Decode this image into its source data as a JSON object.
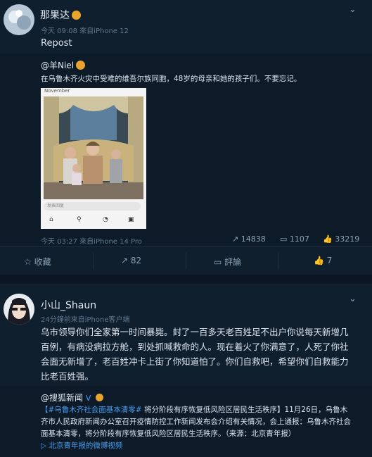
{
  "post1": {
    "user": "那果达",
    "meta": "今天 09:08 來自iPhone 12",
    "text": "Repost",
    "repost": {
      "user": "@羊Niel",
      "text": "在乌鲁木齐火灾中受难的维吾尔族同胞，48岁的母亲和她的孩子们。不要忘记。",
      "photo": {
        "month_label": "November",
        "input_placeholder": "发表回复"
      },
      "meta": "今天 03:27 來自iPhone 14 Pro",
      "stats": {
        "reposts": "14838",
        "comments": "1107",
        "likes": "33219"
      }
    },
    "actions": {
      "favorite": "收藏",
      "repost": "82",
      "comment": "評論",
      "like": "7"
    }
  },
  "post2": {
    "user": "小山_Shaun",
    "meta": "24分鐘前來自iPhone客户端",
    "text": "乌市领导你们全家第一时间暴毙。封了一百多天老百姓足不出户你说每天新增几百例，有病没病拉方舱，到处抓喊救命的人。现在着火了你满意了，人死了你社会面无新增了，老百姓冲卡上街了你知道怕了。你们自救吧，希望你们自救能力比老百姓强。",
    "repost": {
      "user": "@搜狐新闻",
      "tag": "【#乌鲁木齐社会面基本清零#",
      "text": " 将分阶段有序恢复低风险区居民生活秩序】11月26日，乌鲁木齐市人民政府新闻办公室召开疫情防控工作新闻发布会介绍有关情况，会上通报：乌鲁木齐社会面基本清零，将分阶段有序恢复低风险区居民生活秩序。（来源：北京青年报）",
      "link": "北京青年报的微博视频"
    }
  }
}
